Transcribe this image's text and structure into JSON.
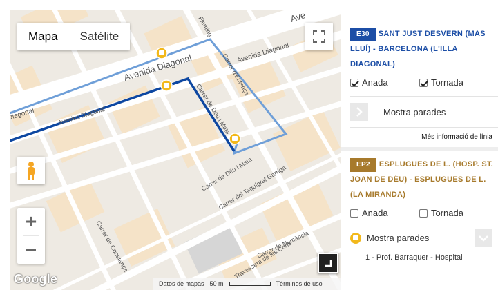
{
  "map": {
    "type_buttons": {
      "map_label": "Mapa",
      "satellite_label": "Satélite"
    },
    "streets": {
      "avenida_diagonal_main": "Avenida Diagonal",
      "avenida_diagonal_right": "Avenida Diagonal",
      "avenida_diagonal_low": "Avenida Diagonal",
      "diagonal_left": "Diagonal",
      "avenida_top": "Ave",
      "fleming": "Fleming",
      "carrer_entenca": "Carrer d'Entença",
      "carrer_deu_mata": "Carrer de Déu i Mata",
      "carrer_deu_mata_2": "Carrer de Déu i Mata",
      "carrer_taquigraf": "Carrer del Taquígraf Garriga",
      "carrer_constanca": "Carrer de Constança",
      "travessera": "Travessera de les Corts",
      "numancia": "Carrer de Numància"
    },
    "colors": {
      "route_e30": "#0d47a1",
      "route_ep2": "#6f9fd8",
      "bus_stop": "#f2b81b"
    },
    "logo": "Google",
    "attribution": {
      "data_label": "Datos de mapas",
      "scale_label": "50 m",
      "terms_label": "Términos de uso"
    }
  },
  "routes": [
    {
      "code": "E30",
      "name": "SANT JUST DESVERN (MAS LLUÍ) - BARCELONA (L'ILLA DIAGONAL)",
      "color": "#1c4ea6",
      "directions": {
        "out_label": "Anada",
        "out_checked": true,
        "back_label": "Tornada",
        "back_checked": true
      },
      "stops_label": "Mostra parades",
      "more_info_label": "Més informació de línia"
    },
    {
      "code": "EP2",
      "name": "ESPLUGUES DE L. (HOSP. ST. JOAN DE DÉU) - ESPLUGUES DE L. (LA MIRANDA)",
      "color": "#a77a2c",
      "directions": {
        "out_label": "Anada",
        "out_checked": false,
        "back_label": "Tornada",
        "back_checked": false
      },
      "stops_label": "Mostra parades",
      "first_stop": "1 - Prof. Barraquer - Hospital"
    }
  ]
}
